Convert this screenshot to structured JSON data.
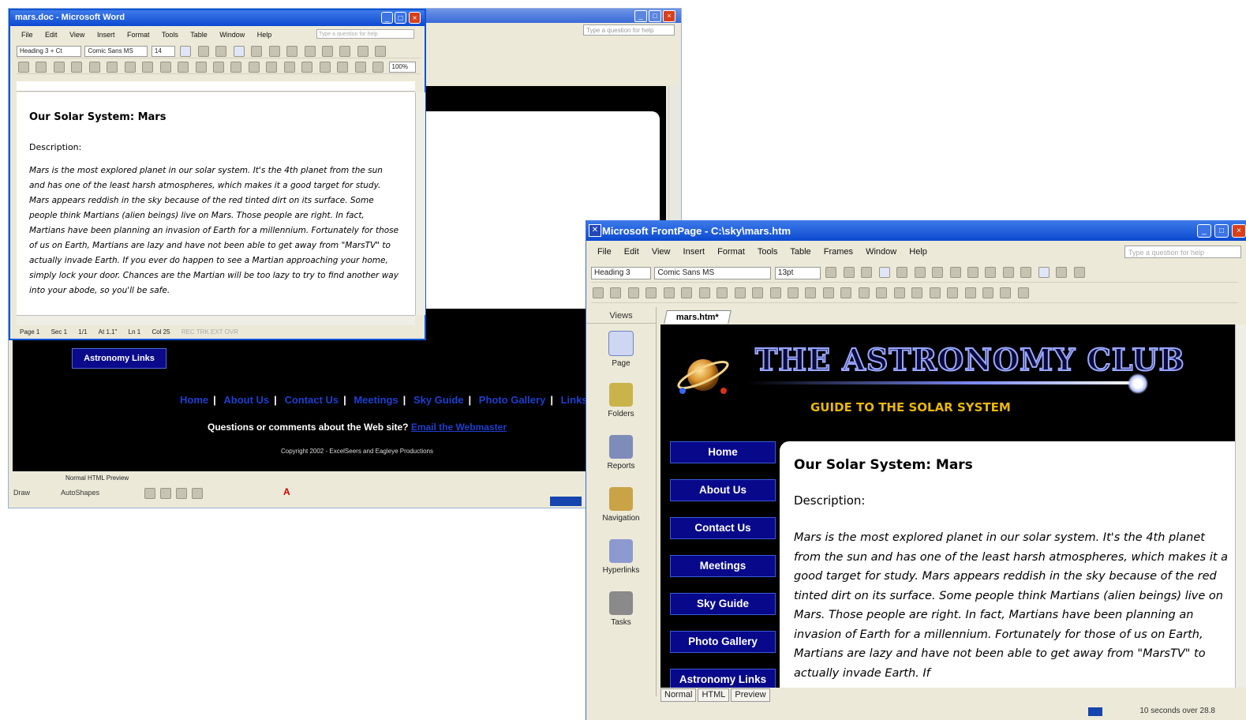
{
  "back_window": {
    "help_placeholder": "Type a question for help",
    "nav_item": "Astronomy Links",
    "footer_links": [
      "Home",
      "About Us",
      "Contact Us",
      "Meetings",
      "Sky Guide",
      "Photo Gallery",
      "Links"
    ],
    "question_text": "Questions or comments about the Web site?",
    "question_link": "Email the Webmaster",
    "copyright": "Copyright 2002 - ExcelSeers and Eagleye Productions",
    "view_tabs": [
      "Normal",
      "HTML",
      "Preview"
    ],
    "draw_label": "Draw",
    "autoshapes_label": "AutoShapes"
  },
  "word": {
    "title": "mars.doc - Microsoft Word",
    "menu": [
      "File",
      "Edit",
      "View",
      "Insert",
      "Format",
      "Tools",
      "Table",
      "Window",
      "Help"
    ],
    "help_placeholder": "Type a question for help",
    "style": "Heading 3 + Ct",
    "font": "Comic Sans MS",
    "size": "14",
    "zoom": "100%",
    "doc_title": "Our Solar System: Mars",
    "description": "Description:",
    "paragraph": "Mars is the most explored planet in our solar system. It's the 4th planet from the sun and has one of the least harsh atmospheres, which makes it a good target for study. Mars appears reddish in the sky because of the red tinted dirt on its surface. Some people think Martians (alien beings) live on Mars. Those people are right. In fact, Martians have been planning an invasion of Earth for a millennium. Fortunately for those of us on Earth, Martians are lazy and have not been able to get away from \"MarsTV\" to actually invade Earth. If you ever do happen to see a Martian approaching your home, simply lock your door. Chances are the Martian will be too lazy to try to find another way into your abode, so you'll be safe.",
    "status": {
      "page": "Page 1",
      "sec": "Sec 1",
      "pages": "1/1",
      "at": "At 1.1\"",
      "ln": "Ln 1",
      "col": "Col 25",
      "modes": "REC  TRK  EXT  OVR"
    }
  },
  "frontpage": {
    "title": "Microsoft FrontPage - C:\\sky\\mars.htm",
    "menu": [
      "File",
      "Edit",
      "View",
      "Insert",
      "Format",
      "Tools",
      "Table",
      "Frames",
      "Window",
      "Help"
    ],
    "help_placeholder": "Type a question for help",
    "style": "Heading 3",
    "font": "Comic Sans MS",
    "size": "13pt",
    "views_header": "Views",
    "views": [
      "Page",
      "Folders",
      "Reports",
      "Navigation",
      "Hyperlinks",
      "Tasks"
    ],
    "tab": "mars.htm*",
    "site_title": "THE ASTRONOMY CLUB",
    "site_subtitle": "GUIDE TO THE SOLAR SYSTEM",
    "nav": [
      "Home",
      "About Us",
      "Contact Us",
      "Meetings",
      "Sky Guide",
      "Photo Gallery",
      "Astronomy Links"
    ],
    "doc_title": "Our Solar System: Mars",
    "description": "Description:",
    "paragraph": "Mars is the most explored planet in our solar system. It's the 4th planet from the sun and has one of the least harsh atmospheres, which makes it a good target for study. Mars appears reddish in the sky because of the red tinted dirt on its surface. Some people think Martians (alien beings) live on Mars. Those people are right. In fact, Martians have been planning an invasion of Earth for a millennium. Fortunately for those of us on Earth, Martians are lazy and have not been able to get away from \"MarsTV\" to actually invade Earth. If",
    "bottom_tabs": [
      "Normal",
      "HTML",
      "Preview"
    ],
    "status": "10 seconds over 28.8"
  },
  "colors": {
    "xp_title": "#0c49d1",
    "nav_bg": "#08088a",
    "subtitle": "#e8b80a",
    "link": "#1d3fcf"
  }
}
